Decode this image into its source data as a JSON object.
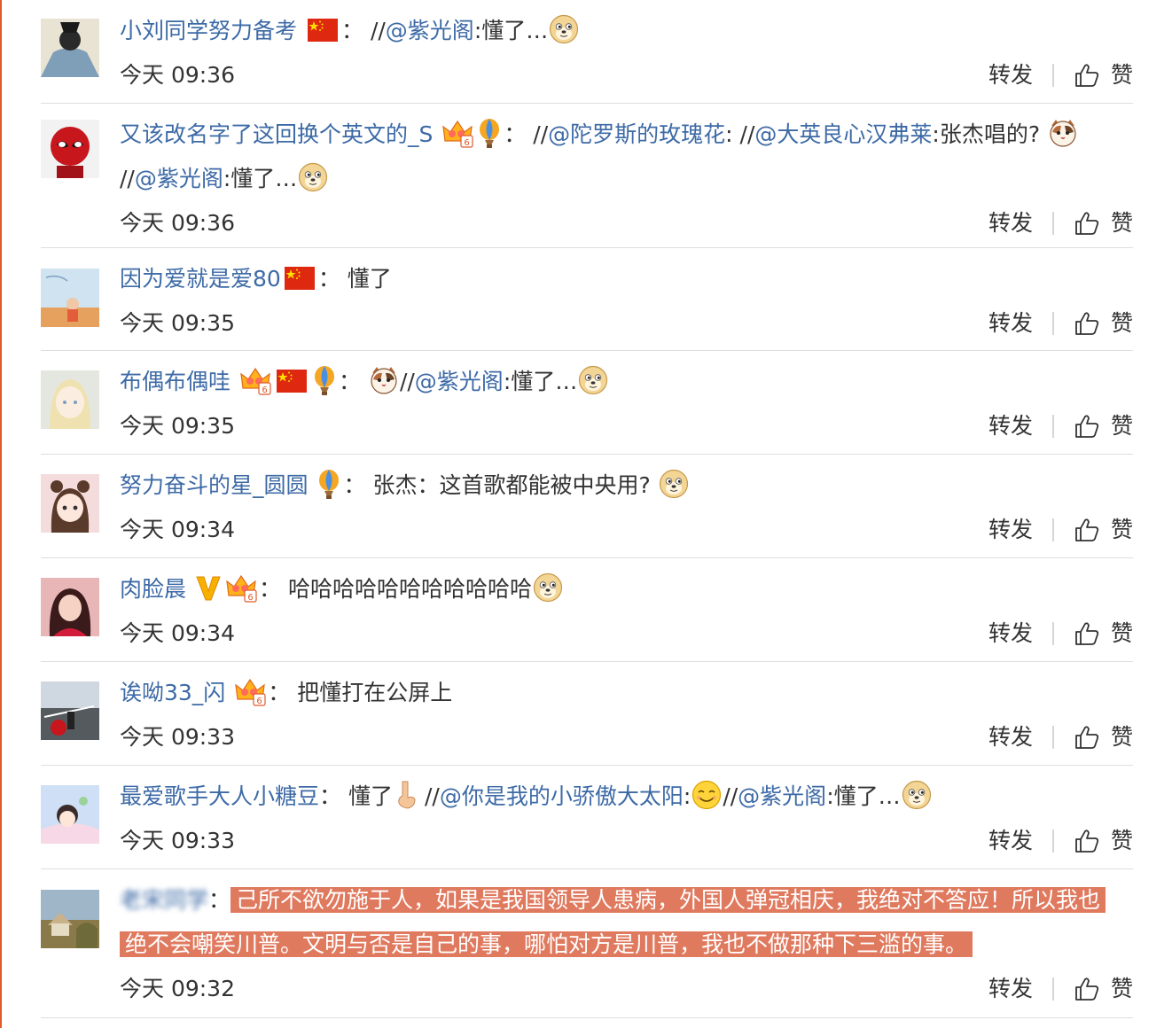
{
  "actions": {
    "repost": "转发",
    "like": "赞"
  },
  "colors": {
    "link": "#3d6aa6",
    "text": "#333333",
    "highlight": "#e07a5f",
    "divider": "#dedede"
  },
  "comments": [
    {
      "username": "小刘同学努力备考",
      "colon": "：",
      "mention_prefix": "//",
      "mention": "@紫光阁",
      "text": ":懂了…",
      "time": "今天 09:36"
    },
    {
      "username": "又该改名字了这回换个英文的_S",
      "colon": "：",
      "m1_prefix": "//",
      "m1": "@陀罗斯的玫瑰花",
      "sep1": ": ",
      "m2_prefix": "//",
      "m2": "@大英良心汉弗莱",
      "text1": ":张杰唱的?",
      "m3_prefix": "//",
      "m3": "@紫光阁",
      "text2": ":懂了…",
      "time": "今天 09:36"
    },
    {
      "username": "因为爱就是爱80",
      "colon": "：",
      "text": "懂了",
      "time": "今天 09:35"
    },
    {
      "username": "布偶布偶哇",
      "colon": "：",
      "mention_prefix": "//",
      "mention": "@紫光阁",
      "text": ":懂了…",
      "time": "今天 09:35"
    },
    {
      "username": "努力奋斗的星_圆圆",
      "colon": "：",
      "text": "张杰：这首歌都能被中央用?",
      "time": "今天 09:34"
    },
    {
      "username": "肉脸晨",
      "colon": "：",
      "text": "哈哈哈哈哈哈哈哈哈哈哈",
      "time": "今天 09:34"
    },
    {
      "username": "诶呦33_闪",
      "colon": "：",
      "text": "把懂打在公屏上",
      "time": "今天 09:33"
    },
    {
      "username": "最爱歌手大人小糖豆",
      "colon": "：",
      "text": "懂了",
      "m1_prefix": "//",
      "m1": "@你是我的小骄傲大太阳",
      "sep1": ":",
      "m2_prefix": "//",
      "m2": "@紫光阁",
      "text2": ":懂了…",
      "time": "今天 09:33"
    },
    {
      "username": "老宋同学",
      "colon": "：",
      "text_line1": "己所不欲勿施于人，如果是我国领导人患病，外国人弹冠相庆，我绝对不答应！所以我也",
      "text_line2": "绝不会嘲笑川普。文明与否是自己的事，哪怕对方是川普，我也不做那种下三滥的事。",
      "time": "今天 09:32"
    }
  ]
}
